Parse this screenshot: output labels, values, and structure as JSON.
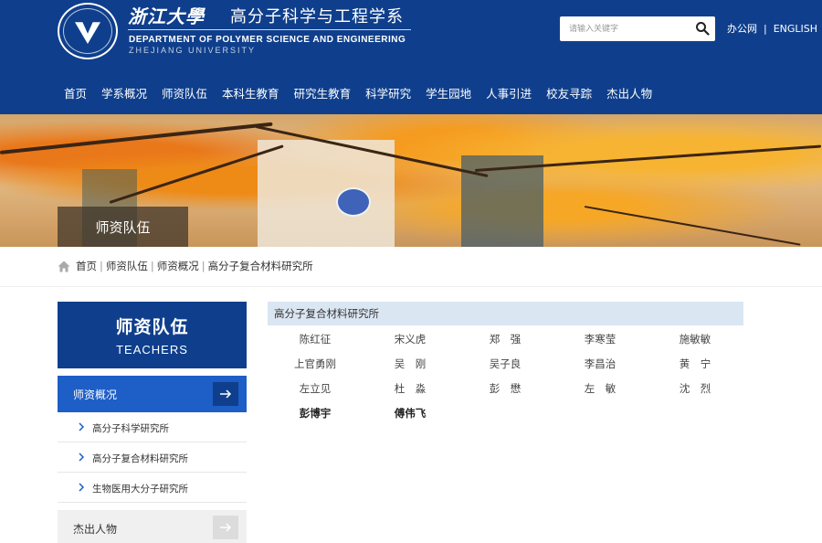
{
  "header": {
    "univ_name_cn": "浙江大學",
    "dept_name_cn": "高分子科学与工程学系",
    "dept_name_en": "DEPARTMENT OF POLYMER SCIENCE AND ENGINEERING",
    "univ_name_en": "ZHEJIANG UNIVERSITY",
    "search_placeholder": "请输入关键字",
    "links": [
      "办公网",
      "ENGLISH"
    ],
    "link_separator": "|",
    "brand_color": "#0f3f8c"
  },
  "nav": {
    "items": [
      "首页",
      "学系概况",
      "师资队伍",
      "本科生教育",
      "研究生教育",
      "科学研究",
      "学生园地",
      "人事引进",
      "校友寻踪",
      "杰出人物"
    ]
  },
  "banner": {
    "label": "师资队伍"
  },
  "breadcrumb": {
    "items": [
      "首页",
      "师资队伍",
      "师资概况"
    ],
    "separator": "|",
    "current": "高分子复合材料研究所"
  },
  "sidebar": {
    "title_cn": "师资队伍",
    "title_en": "TEACHERS",
    "active_item": "师资概况",
    "sub_items": [
      "高分子科学研究所",
      "高分子复合材料研究所",
      "生物医用大分子研究所"
    ],
    "other_item": "杰出人物",
    "accent_color": "#1d5ec7"
  },
  "main": {
    "section_title": "高分子复合材料研究所",
    "people": [
      {
        "name": "陈红征",
        "bold": false
      },
      {
        "name": "宋义虎",
        "bold": false
      },
      {
        "name": "郑　强",
        "bold": false
      },
      {
        "name": "李寒莹",
        "bold": false
      },
      {
        "name": "施敏敏",
        "bold": false
      },
      {
        "name": "上官勇刚",
        "bold": false
      },
      {
        "name": "吴　刚",
        "bold": false
      },
      {
        "name": "吴子良",
        "bold": false
      },
      {
        "name": "李昌治",
        "bold": false
      },
      {
        "name": "黄　宁",
        "bold": false
      },
      {
        "name": "左立见",
        "bold": false
      },
      {
        "name": "杜　淼",
        "bold": false
      },
      {
        "name": "彭　懋",
        "bold": false
      },
      {
        "name": "左　敏",
        "bold": false
      },
      {
        "name": "沈　烈",
        "bold": false
      },
      {
        "name": "彭博宇",
        "bold": true
      },
      {
        "name": "傅伟飞",
        "bold": true
      }
    ]
  }
}
